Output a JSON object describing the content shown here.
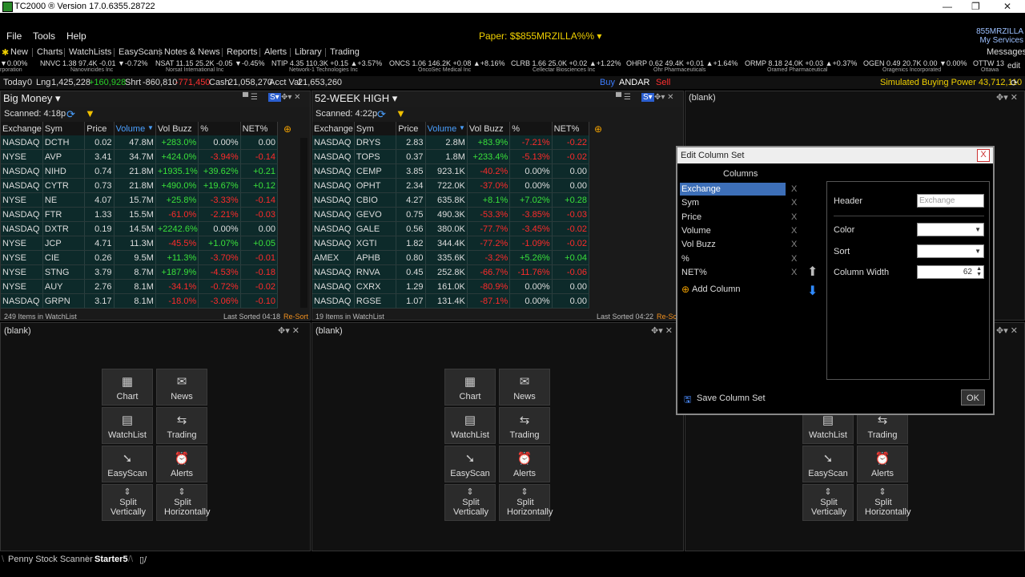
{
  "window": {
    "title": "TC2000 ® Version 17.0.6355.28722",
    "min": "—",
    "max": "❐",
    "close": "✕"
  },
  "menu": {
    "file": "File",
    "tools": "Tools",
    "help": "Help",
    "paper": "Paper: $$855MRZILLA%% ▾",
    "acct_name": "855MRZILLA",
    "acct_services": "My Services",
    "messages": "Messages",
    "edit": "edit"
  },
  "toolbar": [
    "New",
    "Charts",
    "WatchLists",
    "EasyScans",
    "Notes & News",
    "Reports",
    "Alerts",
    "Library",
    "Trading"
  ],
  "ticker": [
    {
      "l1": "▼0.00%",
      "l2": "rporation",
      "cls": "dn"
    },
    {
      "l1": "NNVC 1.38 97.4K -0.01 ▼-0.72%",
      "l2": "Nanoviricides Inc",
      "cls": "dn"
    },
    {
      "l1": "NSAT 11.15 25.2K -0.05 ▼-0.45%",
      "l2": "Norsat International Inc",
      "cls": "dn"
    },
    {
      "l1": "NTIP 4.35 110.3K +0.15 ▲+3.57%",
      "l2": "Network-1 Technologies Inc",
      "cls": "up"
    },
    {
      "l1": "ONCS 1.06 146.2K +0.08 ▲+8.16%",
      "l2": "OncoSec Medical Inc",
      "cls": "up"
    },
    {
      "l1": "CLRB 1.66 25.0K +0.02 ▲+1.22%",
      "l2": "Cellectar Biosciences Inc",
      "cls": "up"
    },
    {
      "l1": "OHRP 0.62 49.4K +0.01 ▲+1.64%",
      "l2": "Ohr Pharmaceuticals",
      "cls": "up"
    },
    {
      "l1": "ORMP 8.18 24.0K +0.03 ▲+0.37%",
      "l2": "Oramed Pharmaceutical",
      "cls": "up"
    },
    {
      "l1": "OGEN 0.49 20.7K 0.00 ▼0.00%",
      "l2": "Oragenics Incorporated",
      "cls": "dn"
    },
    {
      "l1": "OTTW 13",
      "l2": "Ottawa",
      "cls": "up"
    }
  ],
  "acctline": {
    "today_label": "Today",
    "today": "0",
    "lng_label": "Lng",
    "lng": "1,425,228",
    "lng_chg": "+160,928",
    "shrt_label": "Shrt",
    "shrt": "-860,810",
    "shrt_chg": "-771,450",
    "cash_label": "Cash",
    "cash": "21,058,270",
    "acctval_label": "Acct Val",
    "acctval": "21,653,260",
    "buy": "Buy",
    "sym": "ANDAR",
    "sell": "Sell",
    "bp": "Simulated Buying Power 43,712,110"
  },
  "headers": [
    "Exchange",
    "Sym",
    "Price",
    "Volume",
    "Vol Buzz",
    "%",
    "NET%"
  ],
  "pane1": {
    "title": "Big Money ▾",
    "scanned": "Scanned:  4:18p",
    "rows": [
      [
        "NASDAQ",
        "DCTH",
        "0.02",
        "47.8M",
        "+283.0%",
        "0.00%",
        "0.00"
      ],
      [
        "NYSE",
        "AVP",
        "3.41",
        "34.7M",
        "+424.0%",
        "-3.94%",
        "-0.14"
      ],
      [
        "NASDAQ",
        "NIHD",
        "0.74",
        "21.8M",
        "+1935.1%",
        "+39.62%",
        "+0.21"
      ],
      [
        "NASDAQ",
        "CYTR",
        "0.73",
        "21.8M",
        "+490.0%",
        "+19.67%",
        "+0.12"
      ],
      [
        "NYSE",
        "NE",
        "4.07",
        "15.7M",
        "+25.8%",
        "-3.33%",
        "-0.14"
      ],
      [
        "NASDAQ",
        "FTR",
        "1.33",
        "15.5M",
        "-61.0%",
        "-2.21%",
        "-0.03"
      ],
      [
        "NASDAQ",
        "DXTR",
        "0.19",
        "14.5M",
        "+2242.6%",
        "0.00%",
        "0.00"
      ],
      [
        "NYSE",
        "JCP",
        "4.71",
        "11.3M",
        "-45.5%",
        "+1.07%",
        "+0.05"
      ],
      [
        "NYSE",
        "CIE",
        "0.26",
        "9.5M",
        "+11.3%",
        "-3.70%",
        "-0.01"
      ],
      [
        "NYSE",
        "STNG",
        "3.79",
        "8.7M",
        "+187.9%",
        "-4.53%",
        "-0.18"
      ],
      [
        "NYSE",
        "AUY",
        "2.76",
        "8.1M",
        "-34.1%",
        "-0.72%",
        "-0.02"
      ],
      [
        "NASDAQ",
        "GRPN",
        "3.17",
        "8.1M",
        "-18.0%",
        "-3.06%",
        "-0.10"
      ]
    ],
    "foot_left": "249 Items in WatchList",
    "foot_right": "Last Sorted 04:18",
    "resort": "Re-Sort"
  },
  "pane2": {
    "title": "52-WEEK HIGH ▾",
    "scanned": "Scanned:  4:22p",
    "rows": [
      [
        "NASDAQ",
        "DRYS",
        "2.83",
        "2.8M",
        "+83.9%",
        "-7.21%",
        "-0.22"
      ],
      [
        "NASDAQ",
        "TOPS",
        "0.37",
        "1.8M",
        "+233.4%",
        "-5.13%",
        "-0.02"
      ],
      [
        "NASDAQ",
        "CEMP",
        "3.85",
        "923.1K",
        "-40.2%",
        "0.00%",
        "0.00"
      ],
      [
        "NASDAQ",
        "OPHT",
        "2.34",
        "722.0K",
        "-37.0%",
        "0.00%",
        "0.00"
      ],
      [
        "NASDAQ",
        "CBIO",
        "4.27",
        "635.8K",
        "+8.1%",
        "+7.02%",
        "+0.28"
      ],
      [
        "NASDAQ",
        "GEVO",
        "0.75",
        "490.3K",
        "-53.3%",
        "-3.85%",
        "-0.03"
      ],
      [
        "NASDAQ",
        "GALE",
        "0.56",
        "380.0K",
        "-77.7%",
        "-3.45%",
        "-0.02"
      ],
      [
        "NASDAQ",
        "XGTI",
        "1.82",
        "344.4K",
        "-77.2%",
        "-1.09%",
        "-0.02"
      ],
      [
        "AMEX",
        "APHB",
        "0.80",
        "335.6K",
        "-3.2%",
        "+5.26%",
        "+0.04"
      ],
      [
        "NASDAQ",
        "RNVA",
        "0.45",
        "252.8K",
        "-66.7%",
        "-11.76%",
        "-0.06"
      ],
      [
        "NASDAQ",
        "CXRX",
        "1.29",
        "161.0K",
        "-80.9%",
        "0.00%",
        "0.00"
      ],
      [
        "NASDAQ",
        "RGSE",
        "1.07",
        "131.4K",
        "-87.1%",
        "0.00%",
        "0.00"
      ]
    ],
    "foot_left": "19 Items in WatchList",
    "foot_right": "Last Sorted 04:22",
    "resort": "Re-Sc"
  },
  "blank": "(blank)",
  "launch": [
    "Chart",
    "News",
    "WatchList",
    "Trading",
    "EasyScan",
    "Alerts",
    "Split Vertically",
    "Split Horizontally"
  ],
  "dialog": {
    "title": "Edit Column Set",
    "close": "X",
    "columns_label": "Columns",
    "items": [
      "Exchange",
      "Sym",
      "Price",
      "Volume",
      "Vol Buzz",
      "%",
      "NET%"
    ],
    "x": "X",
    "add": "Add Column",
    "header_label": "Header",
    "header_placeholder": "Exchange",
    "color_label": "Color",
    "sort_label": "Sort",
    "width_label": "Column Width",
    "width_value": "62",
    "save": "Save Column Set",
    "ok": "OK"
  },
  "tabs": [
    "Penny Stock Scanner",
    "Starter5"
  ]
}
